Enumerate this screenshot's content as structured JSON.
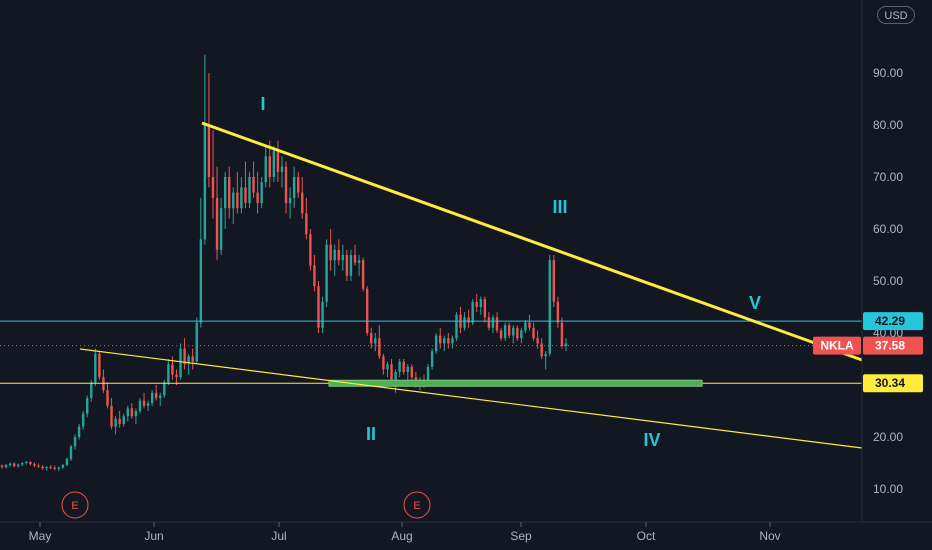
{
  "currency_button": "USD",
  "symbol": "NKLA",
  "chart_data": {
    "type": "candlestick",
    "y_axis": {
      "ticks": [
        "10.00",
        "20.00",
        "30.00",
        "40.00",
        "50.00",
        "60.00",
        "70.00",
        "80.00",
        "90.00"
      ],
      "range": [
        2,
        100
      ],
      "grid": false
    },
    "x_axis": {
      "ticks": [
        "May",
        "Jun",
        "Jul",
        "Aug",
        "Sep",
        "Oct",
        "Nov"
      ]
    },
    "price_tags": [
      {
        "label": "42.29",
        "value": 42.29,
        "color": "#26c6da",
        "text_color": "#131722"
      },
      {
        "label": "37.58",
        "value": 37.58,
        "color": "#ef5350",
        "text_color": "#ffffff",
        "symbol": "NKLA"
      },
      {
        "label": "30.34",
        "value": 30.34,
        "color": "#ffeb3b",
        "text_color": "#131722"
      }
    ],
    "wave_labels": [
      "I",
      "II",
      "III",
      "IV",
      "V"
    ],
    "earnings_markers": [
      "E",
      "E"
    ],
    "horizontal_lines": [
      {
        "value": 42.29,
        "color": "#26c6da",
        "style": "solid"
      },
      {
        "value": 37.58,
        "color": "#ef5350",
        "style": "dotted"
      },
      {
        "value": 30.34,
        "color": "#ffeb3b",
        "style": "solid"
      }
    ],
    "support_zone": {
      "value": 30.34,
      "from": "Jul",
      "to": "Oct",
      "color": "#4caf50"
    },
    "trendlines": [
      {
        "from": [
          "Jun",
          80
        ],
        "to": [
          "Nov",
          35
        ],
        "color": "#ffeb3b",
        "width": 3
      },
      {
        "from": [
          "May",
          37
        ],
        "to": [
          "Nov",
          18
        ],
        "color": "#ffeb3b",
        "width": 1.5
      }
    ],
    "candles": [
      [
        14.5,
        14.7,
        13.9,
        14.2
      ],
      [
        14.2,
        14.8,
        13.9,
        14.6
      ],
      [
        14.6,
        15.1,
        14.3,
        14.9
      ],
      [
        14.9,
        15.1,
        14.2,
        14.4
      ],
      [
        14.4,
        14.9,
        14.1,
        14.7
      ],
      [
        14.7,
        15.2,
        14.4,
        15.0
      ],
      [
        15.0,
        15.4,
        14.7,
        15.2
      ],
      [
        15.2,
        15.3,
        14.5,
        14.8
      ],
      [
        14.8,
        15.1,
        14.2,
        14.5
      ],
      [
        14.5,
        14.9,
        14.1,
        14.3
      ],
      [
        14.3,
        14.6,
        13.7,
        14.0
      ],
      [
        14.0,
        14.4,
        13.5,
        14.2
      ],
      [
        14.2,
        14.6,
        13.8,
        14.1
      ],
      [
        14.1,
        14.5,
        13.6,
        13.9
      ],
      [
        13.9,
        14.3,
        13.4,
        14.1
      ],
      [
        14.1,
        14.8,
        13.9,
        14.6
      ],
      [
        14.6,
        16.0,
        14.4,
        15.8
      ],
      [
        15.8,
        18.5,
        15.4,
        18.2
      ],
      [
        18.2,
        20.5,
        17.6,
        20.0
      ],
      [
        20.0,
        22.5,
        19.5,
        22.0
      ],
      [
        22.0,
        25.0,
        21.4,
        24.5
      ],
      [
        24.5,
        28.0,
        23.8,
        27.5
      ],
      [
        27.5,
        31.0,
        26.8,
        30.5
      ],
      [
        30.5,
        37.0,
        29.8,
        36.0
      ],
      [
        36.0,
        36.5,
        31.0,
        31.5
      ],
      [
        31.5,
        33.0,
        28.5,
        29.0
      ],
      [
        29.0,
        30.5,
        25.5,
        26.0
      ],
      [
        26.0,
        27.5,
        21.5,
        22.0
      ],
      [
        22.0,
        24.0,
        20.5,
        23.5
      ],
      [
        23.5,
        25.0,
        21.8,
        22.5
      ],
      [
        22.5,
        24.5,
        22.0,
        24.0
      ],
      [
        24.0,
        26.0,
        23.0,
        25.5
      ],
      [
        25.5,
        26.5,
        23.5,
        24.0
      ],
      [
        24.0,
        25.5,
        22.5,
        25.0
      ],
      [
        25.0,
        27.5,
        24.5,
        27.0
      ],
      [
        27.0,
        28.5,
        25.5,
        26.0
      ],
      [
        26.0,
        27.0,
        25.0,
        26.5
      ],
      [
        26.5,
        29.0,
        26.0,
        28.5
      ],
      [
        28.5,
        30.0,
        27.0,
        27.5
      ],
      [
        27.5,
        28.5,
        26.0,
        28.0
      ],
      [
        28.0,
        31.0,
        27.5,
        30.5
      ],
      [
        30.5,
        35.0,
        30.0,
        34.0
      ],
      [
        34.0,
        35.5,
        31.0,
        32.0
      ],
      [
        32.0,
        33.0,
        30.0,
        31.5
      ],
      [
        31.5,
        38.0,
        31.0,
        37.0
      ],
      [
        37.0,
        39.0,
        33.0,
        34.0
      ],
      [
        34.0,
        36.0,
        32.0,
        35.5
      ],
      [
        35.5,
        37.0,
        33.0,
        34.5
      ],
      [
        34.5,
        43.0,
        34.0,
        42.0
      ],
      [
        42.0,
        66.0,
        41.0,
        58.0
      ],
      [
        58.0,
        93.5,
        57.0,
        80.0
      ],
      [
        80.0,
        90.0,
        68.0,
        70.0
      ],
      [
        70.0,
        79.0,
        62.0,
        66.0
      ],
      [
        66.0,
        72.0,
        54.0,
        56.0
      ],
      [
        56.0,
        66.0,
        55.0,
        64.0
      ],
      [
        64.0,
        71.0,
        60.0,
        70.0
      ],
      [
        70.0,
        72.0,
        62.0,
        64.0
      ],
      [
        64.0,
        68.0,
        61.0,
        67.0
      ],
      [
        67.0,
        71.0,
        63.0,
        64.0
      ],
      [
        64.0,
        70.0,
        63.0,
        68.0
      ],
      [
        68.0,
        73.0,
        64.0,
        65.0
      ],
      [
        65.0,
        71.0,
        64.0,
        70.0
      ],
      [
        70.0,
        73.0,
        66.0,
        67.0
      ],
      [
        67.0,
        71.0,
        63.0,
        65.0
      ],
      [
        65.0,
        70.0,
        64.0,
        69.0
      ],
      [
        69.0,
        76.0,
        68.0,
        74.0
      ],
      [
        74.0,
        77.0,
        68.0,
        70.0
      ],
      [
        70.0,
        76.0,
        69.0,
        75.0
      ],
      [
        75.0,
        77.0,
        69.0,
        71.0
      ],
      [
        71.0,
        74.0,
        68.0,
        72.0
      ],
      [
        72.0,
        73.0,
        63.0,
        65.0
      ],
      [
        65.0,
        68.0,
        62.0,
        66.0
      ],
      [
        66.0,
        72.0,
        64.0,
        70.0
      ],
      [
        70.0,
        71.0,
        66.0,
        67.0
      ],
      [
        67.0,
        70.0,
        62.0,
        63.0
      ],
      [
        63.0,
        66.0,
        58.0,
        59.0
      ],
      [
        59.0,
        60.0,
        52.0,
        53.0
      ],
      [
        53.0,
        55.0,
        48.0,
        49.0
      ],
      [
        49.0,
        50.0,
        40.0,
        41.0
      ],
      [
        41.0,
        47.0,
        40.0,
        46.0
      ],
      [
        46.0,
        58.0,
        45.0,
        57.0
      ],
      [
        57.0,
        60.0,
        52.0,
        54.0
      ],
      [
        54.0,
        57.0,
        51.0,
        56.0
      ],
      [
        56.0,
        58.0,
        53.0,
        54.0
      ],
      [
        54.0,
        57.0,
        52.0,
        55.0
      ],
      [
        55.0,
        56.0,
        50.0,
        51.0
      ],
      [
        51.0,
        56.0,
        50.0,
        55.0
      ],
      [
        55.0,
        57.0,
        53.0,
        53.5
      ],
      [
        53.5,
        55.0,
        51.0,
        54.0
      ],
      [
        54.0,
        54.5,
        48.0,
        48.5
      ],
      [
        48.5,
        49.0,
        39.5,
        40.0
      ],
      [
        40.0,
        41.0,
        37.0,
        38.0
      ],
      [
        38.0,
        40.0,
        36.5,
        39.0
      ],
      [
        39.0,
        41.5,
        35.0,
        35.5
      ],
      [
        35.5,
        36.0,
        32.0,
        33.0
      ],
      [
        33.0,
        34.5,
        31.5,
        34.0
      ],
      [
        34.0,
        35.0,
        30.0,
        31.0
      ],
      [
        31.0,
        33.0,
        28.5,
        32.5
      ],
      [
        32.5,
        35.0,
        31.5,
        34.5
      ],
      [
        34.5,
        35.0,
        32.0,
        32.5
      ],
      [
        32.5,
        34.0,
        30.5,
        33.5
      ],
      [
        33.5,
        34.0,
        31.0,
        31.5
      ],
      [
        31.5,
        32.5,
        29.5,
        30.0
      ],
      [
        30.0,
        31.5,
        29.0,
        31.0
      ],
      [
        31.0,
        32.0,
        29.5,
        30.5
      ],
      [
        30.5,
        34.0,
        30.0,
        33.5
      ],
      [
        33.5,
        37.0,
        33.0,
        36.5
      ],
      [
        36.5,
        40.0,
        36.0,
        39.5
      ],
      [
        39.5,
        41.0,
        37.0,
        38.0
      ],
      [
        38.0,
        39.5,
        36.5,
        39.0
      ],
      [
        39.0,
        40.0,
        37.0,
        38.0
      ],
      [
        38.0,
        39.5,
        37.0,
        39.0
      ],
      [
        39.0,
        44.0,
        38.5,
        43.5
      ],
      [
        43.5,
        45.0,
        40.0,
        41.0
      ],
      [
        41.0,
        44.0,
        40.5,
        43.0
      ],
      [
        43.0,
        44.5,
        41.0,
        42.0
      ],
      [
        42.0,
        46.5,
        41.5,
        46.0
      ],
      [
        46.0,
        47.5,
        44.0,
        45.0
      ],
      [
        45.0,
        47.0,
        43.5,
        46.5
      ],
      [
        46.5,
        47.0,
        42.0,
        43.0
      ],
      [
        43.0,
        44.0,
        40.5,
        41.0
      ],
      [
        41.0,
        43.5,
        40.0,
        43.0
      ],
      [
        43.0,
        44.0,
        40.0,
        40.5
      ],
      [
        40.5,
        41.0,
        38.5,
        39.0
      ],
      [
        39.0,
        42.0,
        38.5,
        41.5
      ],
      [
        41.5,
        42.0,
        39.0,
        39.5
      ],
      [
        39.5,
        41.5,
        38.0,
        41.0
      ],
      [
        41.0,
        41.5,
        38.5,
        39.0
      ],
      [
        39.0,
        41.0,
        38.0,
        40.5
      ],
      [
        40.5,
        42.5,
        40.0,
        42.0
      ],
      [
        42.0,
        43.5,
        40.5,
        41.0
      ],
      [
        41.0,
        42.0,
        38.5,
        39.0
      ],
      [
        39.0,
        40.5,
        37.0,
        38.0
      ],
      [
        38.0,
        39.0,
        35.0,
        35.5
      ],
      [
        35.5,
        36.5,
        33.0,
        36.0
      ],
      [
        36.0,
        55.0,
        35.5,
        54.0
      ],
      [
        54.0,
        55.0,
        45.0,
        46.0
      ],
      [
        46.0,
        47.0,
        41.0,
        42.0
      ],
      [
        42.0,
        43.0,
        37.0,
        37.5
      ],
      [
        37.5,
        39.0,
        36.5,
        38.0
      ]
    ]
  }
}
